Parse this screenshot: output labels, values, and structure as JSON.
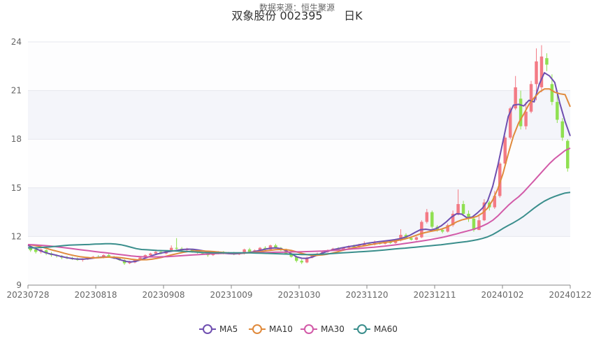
{
  "header": {
    "watermark": "数据来源：恒生聚源",
    "stock_name": "双象股份 002395",
    "period": "日K"
  },
  "chart_data": {
    "type": "candlestick",
    "title": "双象股份 002395 日K",
    "ylim": [
      9,
      24
    ],
    "yticks": [
      "24",
      "21",
      "18",
      "15",
      "12",
      "9"
    ],
    "xticks": [
      "20230728",
      "20230818",
      "20230908",
      "20231009",
      "20231030",
      "20231120",
      "20231211",
      "20240102",
      "20240122"
    ],
    "grid": true,
    "legend_position": "bottom-center",
    "colors": {
      "up": "#f37a85",
      "down": "#8fe051",
      "MA5": "#6f4fb0",
      "MA10": "#e08a3c",
      "MA30": "#d25aa8",
      "MA60": "#3a8e8c"
    },
    "series": [
      {
        "name": "MA5",
        "values": [
          11.45,
          11.32,
          11.18,
          11.05,
          10.95,
          10.88,
          10.8,
          10.73,
          10.67,
          10.62,
          10.6,
          10.61,
          10.64,
          10.68,
          10.72,
          10.74,
          10.72,
          10.66,
          10.55,
          10.46,
          10.43,
          10.48,
          10.58,
          10.7,
          10.82,
          10.92,
          10.99,
          11.05,
          11.1,
          11.15,
          11.2,
          11.22,
          11.21,
          11.17,
          11.11,
          11.06,
          11.02,
          10.99,
          10.96,
          10.94,
          10.93,
          10.95,
          10.98,
          11.02,
          11.08,
          11.15,
          11.22,
          11.28,
          11.3,
          11.25,
          11.12,
          10.93,
          10.75,
          10.66,
          10.65,
          10.73,
          10.85,
          10.98,
          11.09,
          11.18,
          11.25,
          11.31,
          11.37,
          11.42,
          11.48,
          11.54,
          11.6,
          11.64,
          11.68,
          11.72,
          11.76,
          11.8,
          11.86,
          11.95,
          12.08,
          12.26,
          12.42,
          12.45,
          12.4,
          12.48,
          12.65,
          12.9,
          13.2,
          13.4,
          13.38,
          13.15,
          13.2,
          13.45,
          13.75,
          14.2,
          15.1,
          16.4,
          17.9,
          19.4,
          20.1,
          20.15,
          20.05,
          20.4,
          20.3,
          21.4,
          22.1,
          21.9,
          21.5,
          20.2,
          19.1,
          18.2
        ]
      },
      {
        "name": "MA10",
        "values": [
          11.5,
          11.46,
          11.4,
          11.32,
          11.23,
          11.14,
          11.06,
          10.97,
          10.89,
          10.82,
          10.76,
          10.72,
          10.69,
          10.68,
          10.7,
          10.72,
          10.73,
          10.72,
          10.69,
          10.65,
          10.6,
          10.57,
          10.56,
          10.57,
          10.6,
          10.65,
          10.72,
          10.8,
          10.88,
          10.95,
          11.02,
          11.07,
          11.1,
          11.11,
          11.1,
          11.09,
          11.07,
          11.04,
          11.01,
          10.98,
          10.97,
          10.97,
          10.98,
          11.0,
          11.03,
          11.07,
          11.11,
          11.15,
          11.19,
          11.2,
          11.19,
          11.14,
          11.05,
          10.96,
          10.88,
          10.84,
          10.84,
          10.86,
          10.91,
          10.98,
          11.06,
          11.15,
          11.23,
          11.3,
          11.36,
          11.42,
          11.48,
          11.53,
          11.58,
          11.63,
          11.67,
          11.72,
          11.78,
          11.85,
          11.94,
          12.05,
          12.17,
          12.25,
          12.32,
          12.38,
          12.45,
          12.56,
          12.72,
          12.9,
          13.02,
          13.1,
          13.15,
          13.25,
          13.45,
          13.75,
          14.25,
          14.95,
          15.9,
          17.1,
          18.2,
          19.0,
          19.55,
          20.15,
          20.55,
          20.9,
          21.1,
          21.1,
          20.9,
          20.8,
          20.75,
          20.0
        ]
      },
      {
        "name": "MA30",
        "values": [
          11.5,
          11.49,
          11.47,
          11.45,
          11.42,
          11.39,
          11.35,
          11.31,
          11.27,
          11.23,
          11.19,
          11.15,
          11.11,
          11.07,
          11.03,
          11.0,
          10.96,
          10.92,
          10.88,
          10.84,
          10.8,
          10.77,
          10.75,
          10.74,
          10.74,
          10.74,
          10.75,
          10.76,
          10.78,
          10.8,
          10.82,
          10.84,
          10.86,
          10.88,
          10.9,
          10.92,
          10.94,
          10.95,
          10.96,
          10.97,
          10.98,
          10.98,
          10.99,
          10.99,
          11.0,
          11.01,
          11.01,
          11.02,
          11.03,
          11.03,
          11.04,
          11.05,
          11.05,
          11.06,
          11.07,
          11.08,
          11.09,
          11.1,
          11.12,
          11.14,
          11.16,
          11.18,
          11.21,
          11.24,
          11.26,
          11.29,
          11.32,
          11.34,
          11.37,
          11.4,
          11.44,
          11.48,
          11.52,
          11.57,
          11.61,
          11.66,
          11.71,
          11.76,
          11.81,
          11.87,
          11.93,
          12.0,
          12.08,
          12.16,
          12.25,
          12.33,
          12.42,
          12.52,
          12.65,
          12.8,
          13.0,
          13.27,
          13.6,
          13.92,
          14.2,
          14.45,
          14.75,
          15.1,
          15.45,
          15.8,
          16.15,
          16.5,
          16.8,
          17.05,
          17.3,
          17.45
        ]
      },
      {
        "name": "MA60",
        "values": [
          11.3,
          11.3,
          11.31,
          11.33,
          11.35,
          11.38,
          11.41,
          11.44,
          11.47,
          11.48,
          11.49,
          11.5,
          11.51,
          11.53,
          11.54,
          11.55,
          11.55,
          11.53,
          11.49,
          11.42,
          11.33,
          11.25,
          11.2,
          11.18,
          11.16,
          11.14,
          11.13,
          11.12,
          11.11,
          11.1,
          11.09,
          11.07,
          11.05,
          11.03,
          11.01,
          11.0,
          10.99,
          10.99,
          10.99,
          10.99,
          10.99,
          10.99,
          10.99,
          10.99,
          10.98,
          10.97,
          10.96,
          10.95,
          10.94,
          10.93,
          10.92,
          10.91,
          10.9,
          10.89,
          10.89,
          10.89,
          10.9,
          10.91,
          10.93,
          10.95,
          10.97,
          10.99,
          11.01,
          11.03,
          11.05,
          11.07,
          11.09,
          11.11,
          11.14,
          11.17,
          11.2,
          11.23,
          11.26,
          11.28,
          11.31,
          11.34,
          11.37,
          11.4,
          11.43,
          11.46,
          11.49,
          11.53,
          11.57,
          11.61,
          11.65,
          11.69,
          11.74,
          11.8,
          11.88,
          11.98,
          12.12,
          12.3,
          12.5,
          12.68,
          12.85,
          13.04,
          13.25,
          13.5,
          13.75,
          13.98,
          14.18,
          14.34,
          14.47,
          14.58,
          14.68,
          14.72
        ]
      }
    ],
    "candles": [
      {
        "o": 11.4,
        "c": 11.15,
        "h": 11.5,
        "l": 11.05
      },
      {
        "o": 11.2,
        "c": 11.05,
        "h": 11.3,
        "l": 10.95
      },
      {
        "o": 11.05,
        "c": 11.2,
        "h": 11.25,
        "l": 10.95
      },
      {
        "o": 11.15,
        "c": 10.95,
        "h": 11.2,
        "l": 10.85
      },
      {
        "o": 10.95,
        "c": 10.85,
        "h": 11.05,
        "l": 10.75
      },
      {
        "o": 10.85,
        "c": 10.8,
        "h": 10.9,
        "l": 10.7
      },
      {
        "o": 10.8,
        "c": 10.7,
        "h": 10.85,
        "l": 10.6
      },
      {
        "o": 10.7,
        "c": 10.65,
        "h": 10.8,
        "l": 10.6
      },
      {
        "o": 10.65,
        "c": 10.6,
        "h": 10.75,
        "l": 10.55
      },
      {
        "o": 10.6,
        "c": 10.55,
        "h": 10.7,
        "l": 10.5
      },
      {
        "o": 10.55,
        "c": 10.6,
        "h": 10.65,
        "l": 10.45
      },
      {
        "o": 10.6,
        "c": 10.7,
        "h": 10.75,
        "l": 10.55
      },
      {
        "o": 10.7,
        "c": 10.75,
        "h": 10.8,
        "l": 10.65
      },
      {
        "o": 10.75,
        "c": 10.7,
        "h": 10.85,
        "l": 10.65
      },
      {
        "o": 10.7,
        "c": 10.85,
        "h": 10.9,
        "l": 10.65
      },
      {
        "o": 10.85,
        "c": 10.75,
        "h": 10.95,
        "l": 10.7
      },
      {
        "o": 10.75,
        "c": 10.65,
        "h": 10.8,
        "l": 10.6
      },
      {
        "o": 10.65,
        "c": 10.55,
        "h": 10.7,
        "l": 10.5
      },
      {
        "o": 10.55,
        "c": 10.35,
        "h": 10.6,
        "l": 10.25
      },
      {
        "o": 10.35,
        "c": 10.45,
        "h": 10.5,
        "l": 10.3
      },
      {
        "o": 10.4,
        "c": 10.55,
        "h": 10.6,
        "l": 10.35
      },
      {
        "o": 10.55,
        "c": 10.7,
        "h": 10.75,
        "l": 10.5
      },
      {
        "o": 10.7,
        "c": 10.85,
        "h": 10.9,
        "l": 10.65
      },
      {
        "o": 10.85,
        "c": 10.95,
        "h": 11.0,
        "l": 10.8
      },
      {
        "o": 10.95,
        "c": 11.05,
        "h": 11.1,
        "l": 10.9
      },
      {
        "o": 11.05,
        "c": 10.95,
        "h": 11.1,
        "l": 10.9
      },
      {
        "o": 10.95,
        "c": 11.1,
        "h": 11.15,
        "l": 10.9
      },
      {
        "o": 11.1,
        "c": 11.3,
        "h": 11.45,
        "l": 11.05
      },
      {
        "o": 11.3,
        "c": 11.25,
        "h": 11.9,
        "l": 11.2
      },
      {
        "o": 11.25,
        "c": 11.15,
        "h": 11.35,
        "l": 11.1
      },
      {
        "o": 11.15,
        "c": 11.2,
        "h": 11.3,
        "l": 11.1
      },
      {
        "o": 11.2,
        "c": 11.05,
        "h": 11.25,
        "l": 11.0
      },
      {
        "o": 11.05,
        "c": 11.0,
        "h": 11.1,
        "l": 10.95
      },
      {
        "o": 11.0,
        "c": 10.95,
        "h": 11.05,
        "l": 10.85
      },
      {
        "o": 10.95,
        "c": 10.85,
        "h": 11.0,
        "l": 10.75
      },
      {
        "o": 10.85,
        "c": 10.95,
        "h": 11.0,
        "l": 10.8
      },
      {
        "o": 10.95,
        "c": 11.05,
        "h": 11.1,
        "l": 10.9
      },
      {
        "o": 11.05,
        "c": 10.95,
        "h": 11.1,
        "l": 10.9
      },
      {
        "o": 10.95,
        "c": 11.0,
        "h": 11.05,
        "l": 10.9
      },
      {
        "o": 11.0,
        "c": 10.9,
        "h": 11.05,
        "l": 10.85
      },
      {
        "o": 10.9,
        "c": 10.95,
        "h": 11.0,
        "l": 10.85
      },
      {
        "o": 10.95,
        "c": 11.2,
        "h": 11.25,
        "l": 10.9
      },
      {
        "o": 11.2,
        "c": 11.05,
        "h": 11.3,
        "l": 11.0
      },
      {
        "o": 11.05,
        "c": 11.15,
        "h": 11.2,
        "l": 11.0
      },
      {
        "o": 11.15,
        "c": 11.3,
        "h": 11.35,
        "l": 11.1
      },
      {
        "o": 11.3,
        "c": 11.2,
        "h": 11.4,
        "l": 11.15
      },
      {
        "o": 11.2,
        "c": 11.45,
        "h": 11.5,
        "l": 11.15
      },
      {
        "o": 11.45,
        "c": 11.3,
        "h": 11.55,
        "l": 11.25
      },
      {
        "o": 11.3,
        "c": 11.2,
        "h": 11.35,
        "l": 11.1
      },
      {
        "o": 11.2,
        "c": 10.95,
        "h": 11.25,
        "l": 10.9
      },
      {
        "o": 10.95,
        "c": 10.75,
        "h": 11.0,
        "l": 10.7
      },
      {
        "o": 10.75,
        "c": 10.5,
        "h": 10.8,
        "l": 10.4
      },
      {
        "o": 10.5,
        "c": 10.4,
        "h": 10.6,
        "l": 10.3
      },
      {
        "o": 10.4,
        "c": 10.7,
        "h": 10.75,
        "l": 10.35
      },
      {
        "o": 10.7,
        "c": 10.85,
        "h": 10.9,
        "l": 10.65
      },
      {
        "o": 10.85,
        "c": 10.95,
        "h": 11.0,
        "l": 10.8
      },
      {
        "o": 10.95,
        "c": 11.05,
        "h": 11.1,
        "l": 10.9
      },
      {
        "o": 11.05,
        "c": 11.15,
        "h": 11.2,
        "l": 11.0
      },
      {
        "o": 11.15,
        "c": 11.25,
        "h": 11.3,
        "l": 11.1
      },
      {
        "o": 11.25,
        "c": 11.2,
        "h": 11.35,
        "l": 11.15
      },
      {
        "o": 11.2,
        "c": 11.3,
        "h": 11.35,
        "l": 11.15
      },
      {
        "o": 11.3,
        "c": 11.4,
        "h": 11.45,
        "l": 11.25
      },
      {
        "o": 11.4,
        "c": 11.35,
        "h": 11.5,
        "l": 11.3
      },
      {
        "o": 11.35,
        "c": 11.45,
        "h": 11.55,
        "l": 11.3
      },
      {
        "o": 11.45,
        "c": 11.55,
        "h": 11.7,
        "l": 11.4
      },
      {
        "o": 11.55,
        "c": 11.5,
        "h": 11.65,
        "l": 11.45
      },
      {
        "o": 11.5,
        "c": 11.6,
        "h": 11.75,
        "l": 11.45
      },
      {
        "o": 11.6,
        "c": 11.55,
        "h": 11.7,
        "l": 11.5
      },
      {
        "o": 11.55,
        "c": 11.65,
        "h": 11.75,
        "l": 11.5
      },
      {
        "o": 11.65,
        "c": 11.6,
        "h": 11.75,
        "l": 11.55
      },
      {
        "o": 11.6,
        "c": 11.75,
        "h": 11.85,
        "l": 11.55
      },
      {
        "o": 11.75,
        "c": 12.1,
        "h": 12.45,
        "l": 11.7
      },
      {
        "o": 12.1,
        "c": 11.9,
        "h": 12.2,
        "l": 11.85
      },
      {
        "o": 11.9,
        "c": 11.8,
        "h": 12.0,
        "l": 11.75
      },
      {
        "o": 11.8,
        "c": 11.95,
        "h": 12.0,
        "l": 11.75
      },
      {
        "o": 11.95,
        "c": 12.9,
        "h": 13.0,
        "l": 11.9
      },
      {
        "o": 12.9,
        "c": 13.5,
        "h": 13.7,
        "l": 12.8
      },
      {
        "o": 13.5,
        "c": 12.6,
        "h": 13.6,
        "l": 12.5
      },
      {
        "o": 12.6,
        "c": 12.4,
        "h": 12.7,
        "l": 12.3
      },
      {
        "o": 12.4,
        "c": 12.3,
        "h": 12.5,
        "l": 12.2
      },
      {
        "o": 12.3,
        "c": 12.7,
        "h": 12.8,
        "l": 12.25
      },
      {
        "o": 12.7,
        "c": 13.4,
        "h": 13.6,
        "l": 12.6
      },
      {
        "o": 13.4,
        "c": 14.0,
        "h": 14.9,
        "l": 13.3
      },
      {
        "o": 14.0,
        "c": 13.4,
        "h": 14.2,
        "l": 13.3
      },
      {
        "o": 13.4,
        "c": 13.1,
        "h": 13.6,
        "l": 12.9
      },
      {
        "o": 13.1,
        "c": 12.4,
        "h": 13.2,
        "l": 12.3
      },
      {
        "o": 12.4,
        "c": 13.0,
        "h": 13.3,
        "l": 12.4
      },
      {
        "o": 13.0,
        "c": 14.1,
        "h": 14.3,
        "l": 12.95
      },
      {
        "o": 14.1,
        "c": 13.8,
        "h": 14.2,
        "l": 13.6
      },
      {
        "o": 13.8,
        "c": 14.5,
        "h": 14.8,
        "l": 13.7
      },
      {
        "o": 14.5,
        "c": 16.5,
        "h": 16.6,
        "l": 14.4
      },
      {
        "o": 16.5,
        "c": 18.1,
        "h": 18.2,
        "l": 16.4
      },
      {
        "o": 18.1,
        "c": 19.9,
        "h": 20.0,
        "l": 18.0
      },
      {
        "o": 19.9,
        "c": 21.2,
        "h": 21.9,
        "l": 19.8
      },
      {
        "o": 20.5,
        "c": 18.8,
        "h": 21.0,
        "l": 18.6
      },
      {
        "o": 18.8,
        "c": 19.7,
        "h": 20.3,
        "l": 18.6
      },
      {
        "o": 19.7,
        "c": 21.4,
        "h": 21.6,
        "l": 19.6
      },
      {
        "o": 21.4,
        "c": 22.8,
        "h": 23.6,
        "l": 20.4
      },
      {
        "o": 21.2,
        "c": 23.1,
        "h": 23.8,
        "l": 20.9
      },
      {
        "o": 23.0,
        "c": 22.6,
        "h": 23.3,
        "l": 22.2
      },
      {
        "o": 21.4,
        "c": 20.3,
        "h": 22.0,
        "l": 20.1
      },
      {
        "o": 20.3,
        "c": 19.2,
        "h": 20.8,
        "l": 19.0
      },
      {
        "o": 19.1,
        "c": 18.1,
        "h": 19.3,
        "l": 17.9
      },
      {
        "o": 17.9,
        "c": 16.2,
        "h": 18.0,
        "l": 16.0
      }
    ]
  },
  "legend": [
    {
      "label": "MA5",
      "color": "#6f4fb0"
    },
    {
      "label": "MA10",
      "color": "#e08a3c"
    },
    {
      "label": "MA30",
      "color": "#d25aa8"
    },
    {
      "label": "MA60",
      "color": "#3a8e8c"
    }
  ]
}
